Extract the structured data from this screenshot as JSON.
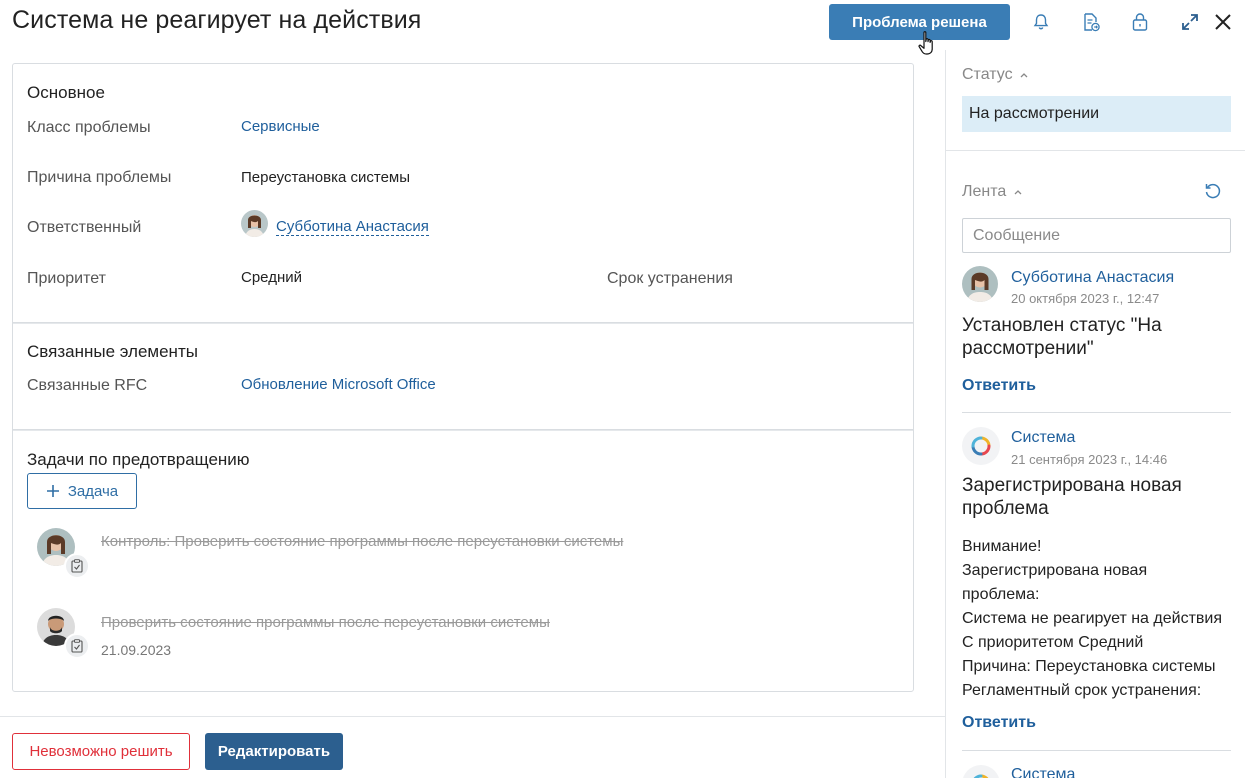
{
  "header": {
    "title": "Система не реагирует на действия",
    "primary_button": "Проблема решена"
  },
  "main": {
    "basic": {
      "title": "Основное",
      "fields": {
        "problem_class": {
          "label": "Класс проблемы",
          "value": "Сервисные"
        },
        "problem_cause": {
          "label": "Причина проблемы",
          "value": "Переустановка системы"
        },
        "responsible": {
          "label": "Ответственный",
          "value": "Субботина Анастасия"
        },
        "priority": {
          "label": "Приоритет",
          "value": "Средний"
        },
        "deadline": {
          "label": "Срок устранения",
          "value": ""
        }
      }
    },
    "related": {
      "title": "Связанные элементы",
      "rfc_label": "Связанные RFC",
      "rfc_value": "Обновление Microsoft Office"
    },
    "prevention": {
      "title": "Задачи по предотвращению",
      "add_button": "Задача",
      "tasks": [
        {
          "text": "Контроль: Проверить состояние программы после переустановки системы",
          "date": ""
        },
        {
          "text": "Проверить состояние программы после переустановки системы",
          "date": "21.09.2023"
        }
      ]
    }
  },
  "footer": {
    "cannot_solve": "Невозможно решить",
    "edit": "Редактировать"
  },
  "sidebar": {
    "status_heading": "Статус",
    "status_value": "На рассмотрении",
    "feed_heading": "Лента",
    "message_placeholder": "Сообщение",
    "feed": [
      {
        "author": "Субботина Анастасия",
        "time": "20 октября 2023 г., 12:47",
        "title": "Установлен статус \"На рассмотрении\"",
        "reply": "Ответить"
      },
      {
        "author": "Система",
        "time": "21 сентября 2023 г., 14:46",
        "title": "Зарегистрирована новая проблема",
        "body": [
          "Внимание!",
          "Зарегистрирована новая",
          "проблема:",
          "Система не реагирует на действия",
          "С приоритетом Средний",
          "Причина: Переустановка системы",
          "Регламентный срок устранения:"
        ],
        "reply": "Ответить"
      },
      {
        "author": "Система"
      }
    ]
  },
  "colors": {
    "primary": "#3a7db5",
    "link": "#1f5f9c",
    "danger": "#e0303a",
    "status_bg": "#dcedf7"
  }
}
